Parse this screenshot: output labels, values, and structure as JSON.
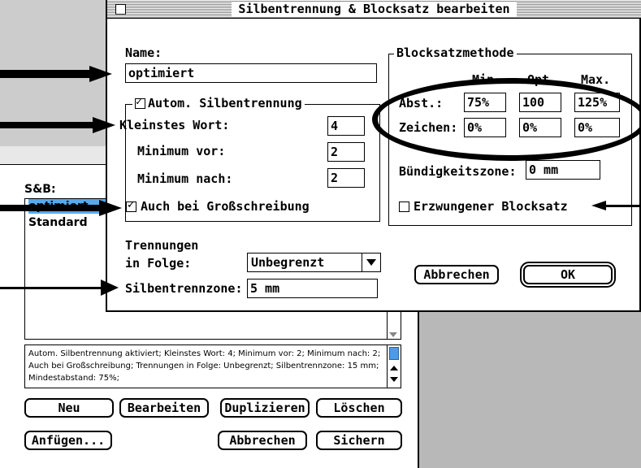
{
  "dialog": {
    "title": "Silbentrennung & Blocksatz bearbeiten",
    "name_label": "Name:",
    "name_value": "optimiert",
    "hyphenation": {
      "checkbox_label": "Autom. Silbentrennung",
      "checked": true,
      "smallest_word_label": "Kleinstes Wort:",
      "smallest_word_value": "4",
      "min_before_label": "Minimum vor:",
      "min_before_value": "2",
      "min_after_label": "Minimum nach:",
      "min_after_value": "2",
      "capitals_label": "Auch bei Großschreibung",
      "capitals_checked": true
    },
    "consecutive_label_1": "Trennungen",
    "consecutive_label_2": "in Folge:",
    "consecutive_value": "Unbegrenzt",
    "hyphen_zone_label": "Silbentrennzone:",
    "hyphen_zone_value": "5 mm",
    "justification": {
      "title": "Blocksatzmethode",
      "col_min": "Min.",
      "col_opt": "Opt.",
      "col_max": "Max.",
      "space_label": "Abst.:",
      "space_min": "75%",
      "space_opt": "100",
      "space_max": "125%",
      "char_label": "Zeichen:",
      "char_min": "0%",
      "char_opt": "0%",
      "char_max": "0%",
      "flush_zone_label": "Bündigkeitszone:",
      "flush_zone_value": "0 mm",
      "forced_label": "Erzwungener Blocksatz",
      "forced_checked": false
    },
    "cancel_label": "Abbrechen",
    "ok_label": "OK"
  },
  "background": {
    "list_label": "S&B:",
    "list_items": [
      "optimiert",
      "Standard"
    ],
    "description": "Autom. Silbentrennung aktiviert; Kleinstes Wort: 4; Minimum vor: 2; Minimum nach: 2; Auch bei Großschreibung; Trennungen in Folge: Unbegrenzt; Silbentrennzone: 15 mm; Mindestabstand: 75%;",
    "buttons": {
      "new": "Neu",
      "edit": "Bearbeiten",
      "duplicate": "Duplizieren",
      "delete": "Löschen",
      "append": "Anfügen...",
      "cancel": "Abbrechen",
      "save": "Sichern"
    }
  },
  "colors": {
    "selection": "#55aaee",
    "scroll_thumb": "#4d9ae6"
  }
}
